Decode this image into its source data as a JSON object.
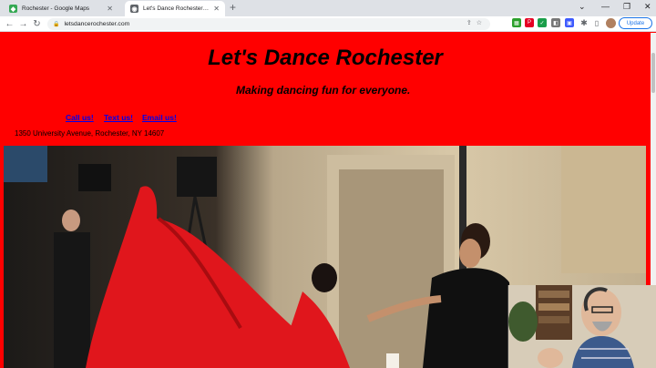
{
  "browser": {
    "tabs": [
      {
        "title": "Rochester - Google Maps",
        "active": false,
        "icon": "google-maps-icon"
      },
      {
        "title": "Let's Dance Rochester Dance St...",
        "active": true,
        "icon": "site-favicon-icon"
      }
    ],
    "url": "letsdancerochester.com",
    "update_label": "Update"
  },
  "site": {
    "title": "Let's Dance Rochester",
    "tagline": "Making dancing fun for everyone.",
    "links": {
      "call": "Call us!",
      "text": "Text us!",
      "email": "Email us!"
    },
    "address": "1350 University Avenue, Rochester, NY 14607"
  },
  "colors": {
    "page_background": "#ff0000",
    "link": "#0000ee",
    "dress": "#e0161c"
  }
}
